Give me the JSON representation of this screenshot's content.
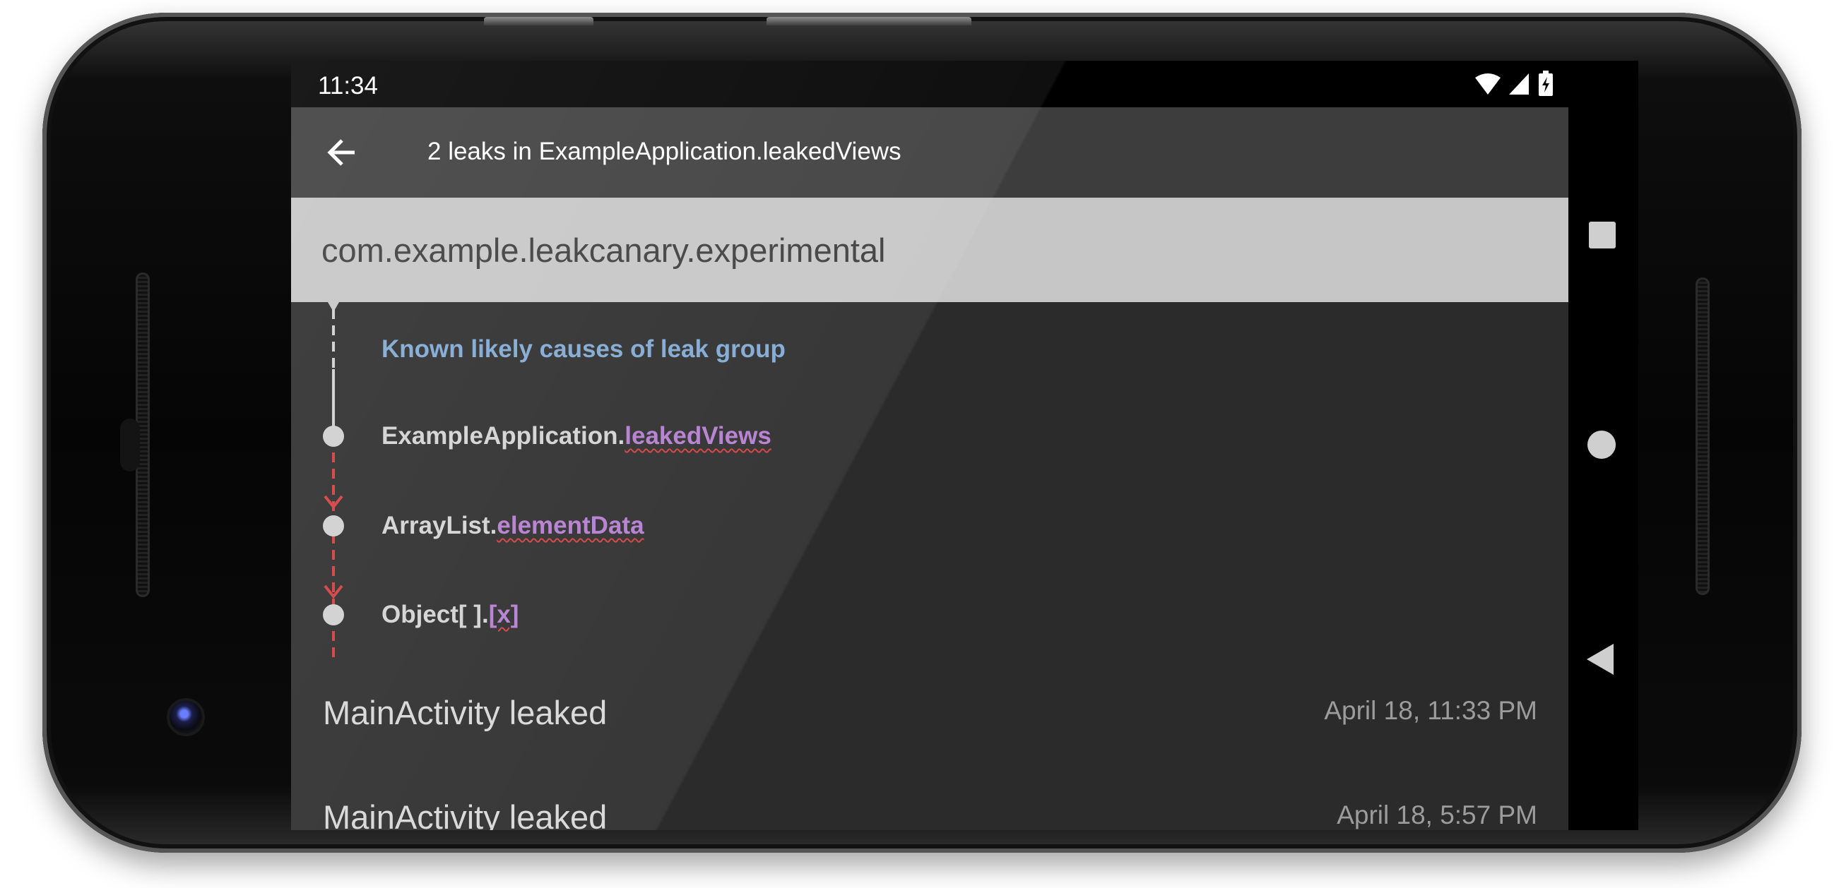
{
  "status_bar": {
    "time": "11:34"
  },
  "toolbar": {
    "back_icon": "arrow-back-icon",
    "title": "2 leaks in ExampleApplication.leakedViews"
  },
  "group": {
    "title": "com.example.leakcanary.experimental"
  },
  "trace": {
    "known_causes_label": "Known likely causes of leak group",
    "nodes": [
      {
        "class_name": "ExampleApplication.",
        "field": "leakedViews"
      },
      {
        "class_name": "ArrayList.",
        "field": "elementData"
      },
      {
        "class_name": "Object[ ].",
        "field": "[x]"
      }
    ]
  },
  "leaks": [
    {
      "title": "MainActivity leaked",
      "date": "April 18, 11:33 PM"
    },
    {
      "title": "MainActivity leaked",
      "date": "April 18, 5:57 PM"
    }
  ],
  "nav_bar": {
    "recents_icon": "square-recents-icon",
    "home_icon": "circle-home-icon",
    "back_icon": "triangle-back-icon"
  },
  "colors": {
    "toolbar": "#3d3d3d",
    "group_header": "#c6c6c6",
    "known_causes": "#7fa8d2",
    "field": "#b47cd0",
    "leak_trace": "#d23c3c"
  }
}
